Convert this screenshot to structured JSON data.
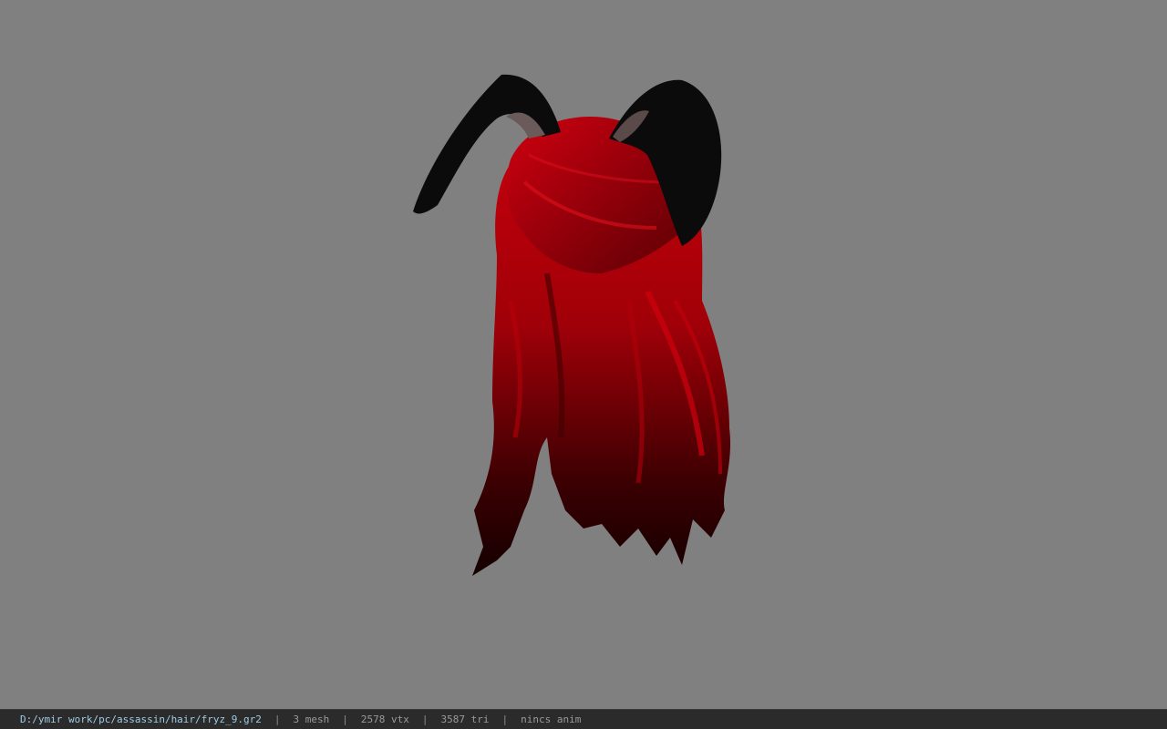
{
  "viewer": {
    "background_color": "#808080",
    "model_subject": "red long hair with black bunny ears"
  },
  "status": {
    "file_path": "D:/ymir work/pc/assassin/hair/fryz_9.gr2",
    "separator": "|",
    "mesh_count": "3 mesh",
    "vertex_count": "2578 vtx",
    "triangle_count": "3587 tri",
    "anim_status": "nincs anim"
  },
  "colors": {
    "hair": "#b0000a",
    "hair_dark": "#2a0000",
    "ears": "#0a0a0a",
    "ear_inner": "#6a5a5a",
    "statusbar_bg": "#2b2b2b",
    "path_text": "#9ecbe6"
  }
}
